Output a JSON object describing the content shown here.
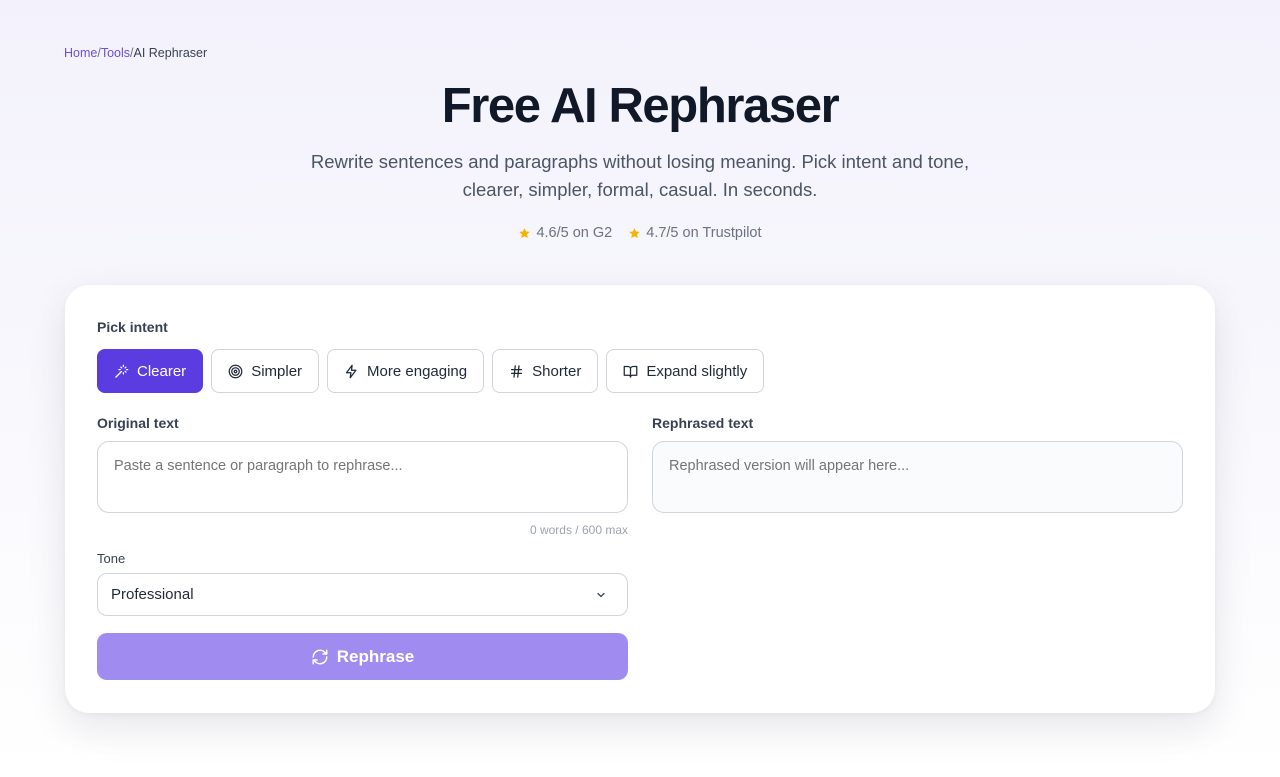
{
  "breadcrumb": {
    "home": "Home",
    "tools": "Tools",
    "current": "AI Rephraser",
    "separator": "/"
  },
  "hero": {
    "title": "Free AI Rephraser",
    "subtitle": "Rewrite sentences and paragraphs without losing meaning. Pick intent and tone, clearer, simpler, formal, casual. In seconds."
  },
  "ratings": [
    {
      "text": "4.6/5 on G2",
      "icon": "star-icon"
    },
    {
      "text": "4.7/5 on Trustpilot",
      "icon": "star-icon"
    }
  ],
  "colors": {
    "accent": "#5b3ce0",
    "button_disabled": "#a08bf0",
    "star": "#f5b400",
    "link": "#6d4fd8"
  },
  "form": {
    "intent_label": "Pick intent",
    "intents": [
      {
        "label": "Clearer",
        "icon": "magic-wand-icon",
        "active": true
      },
      {
        "label": "Simpler",
        "icon": "target-icon",
        "active": false
      },
      {
        "label": "More engaging",
        "icon": "lightning-icon",
        "active": false
      },
      {
        "label": "Shorter",
        "icon": "hash-icon",
        "active": false
      },
      {
        "label": "Expand slightly",
        "icon": "book-open-icon",
        "active": false
      }
    ],
    "original_label": "Original text",
    "original_placeholder": "Paste a sentence or paragraph to rephrase...",
    "original_value": "",
    "word_count": "0 words / 600 max",
    "output_label": "Rephrased text",
    "output_placeholder": "Rephrased version will appear here...",
    "tone_label": "Tone",
    "tone_value": "Professional",
    "submit_label": "Rephrase"
  }
}
